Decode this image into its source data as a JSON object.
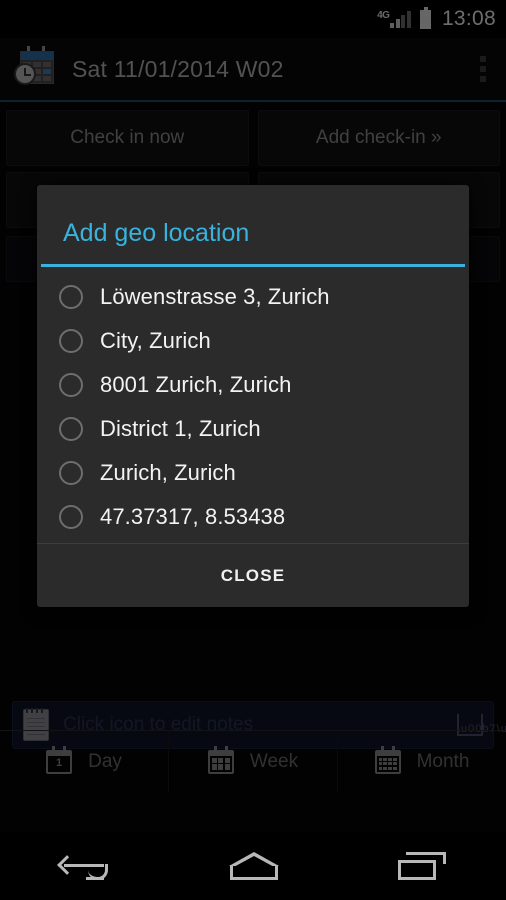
{
  "status_bar": {
    "network_label": "4G",
    "time": "13:08",
    "signal_icon": "signal-bars-icon",
    "battery_icon": "battery-full-icon"
  },
  "action_bar": {
    "app_icon": "calendar-clock-icon",
    "title": "Sat 11/01/2014 W02",
    "overflow_icon": "overflow-menu-icon"
  },
  "background": {
    "buttons": [
      {
        "label": "Check in now"
      },
      {
        "label": "Add check-in »"
      }
    ]
  },
  "notes": {
    "icon": "notepad-icon",
    "placeholder": "Click icon to edit notes",
    "expand_icon": "expand-ellipsis-icon"
  },
  "view_tabs": [
    {
      "label": "Day",
      "icon": "calendar-day-icon",
      "day_number": "1"
    },
    {
      "label": "Week",
      "icon": "calendar-week-icon"
    },
    {
      "label": "Month",
      "icon": "calendar-month-icon"
    }
  ],
  "dialog": {
    "title": "Add geo location",
    "options": [
      {
        "label": "Löwenstrasse 3, Zurich",
        "selected": false
      },
      {
        "label": "City, Zurich",
        "selected": false
      },
      {
        "label": "8001 Zurich, Zurich",
        "selected": false
      },
      {
        "label": "District 1, Zurich",
        "selected": false
      },
      {
        "label": "Zurich, Zurich",
        "selected": false
      },
      {
        "label": "47.37317, 8.53438",
        "selected": false
      }
    ],
    "close_label": "CLOSE"
  },
  "nav_bar": {
    "back_icon": "back-arrow-icon",
    "home_icon": "home-icon",
    "recents_icon": "recent-apps-icon"
  },
  "colors": {
    "accent": "#39b3dd",
    "dialog_bg": "#2b2b2b",
    "screen_bg": "#060608",
    "text_primary": "#f3f3f3",
    "text_secondary": "#8e8e8e"
  }
}
